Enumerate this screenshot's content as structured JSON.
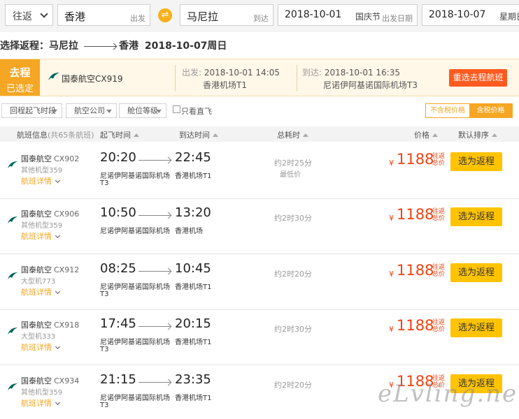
{
  "search": {
    "trip_type": "往返",
    "origin": "香港",
    "origin_hint": "出发",
    "destination": "马尼拉",
    "destination_hint": "到达",
    "depart_date": "2018-10-01",
    "depart_holiday": "国庆节",
    "depart_hint": "出发日期",
    "return_date": "2018-10-07",
    "return_weekday": "星期日"
  },
  "route_title": {
    "prefix": "选择返程：马尼拉",
    "to": "香港",
    "date": "2018-10-07周日"
  },
  "selected": {
    "badge_top": "去程",
    "badge_bottom": "已选定",
    "airline": "国泰航空CX919",
    "dep_label": "出发:",
    "dep_time": "2018-10-01 14:05",
    "dep_airport": "香港机场T1",
    "arr_label": "到达:",
    "arr_time": "2018-10-01 16:35",
    "arr_airport": "尼诺伊阿基诺国际机场T3",
    "reselect_button": "重选去程航班"
  },
  "filters": {
    "time": "回程起飞时段",
    "airline": "航空公司",
    "cabin": "舱位等级",
    "direct_only": "只看直飞",
    "tax_excluded": "不含税价格",
    "tax_included": "含税价格"
  },
  "table_header": {
    "flight_info": "航班信息",
    "flight_count": "(共65条航班)",
    "dep_time": "起飞时间",
    "arr_time": "到达时间",
    "duration": "总耗时",
    "price": "价格",
    "sort": "默认排序"
  },
  "flights": [
    {
      "airline": "国泰航空",
      "no": "CX902",
      "aircraft": "其他机型359",
      "detail": "航班详情",
      "dep": "20:20",
      "arr": "22:45",
      "dep_airport": "尼诺伊阿基诺国际机场",
      "dep_terminal": "T3",
      "arr_airport": "香港机场T1",
      "duration": "约2时25分",
      "lowest": "最低价",
      "currency": "¥",
      "price": "1188",
      "note": "往返总价",
      "button": "选为返程"
    },
    {
      "airline": "国泰航空",
      "no": "CX906",
      "aircraft": "其他机型359",
      "detail": "航班详情",
      "dep": "10:50",
      "arr": "13:20",
      "dep_airport": "尼诺伊阿基诺国际机场",
      "dep_terminal": "",
      "arr_airport": "香港机场",
      "duration": "约2时30分",
      "lowest": "",
      "currency": "¥",
      "price": "1188",
      "note": "往返总价",
      "button": "选为返程"
    },
    {
      "airline": "国泰航空",
      "no": "CX912",
      "aircraft": "大型机773",
      "detail": "航班详情",
      "dep": "08:25",
      "arr": "10:45",
      "dep_airport": "尼诺伊阿基诺国际机场",
      "dep_terminal": "T3",
      "arr_airport": "香港机场T1",
      "duration": "约2时20分",
      "lowest": "",
      "currency": "¥",
      "price": "1188",
      "note": "往返总价",
      "button": "选为返程"
    },
    {
      "airline": "国泰航空",
      "no": "CX918",
      "aircraft": "大型机333",
      "detail": "航班详情",
      "dep": "17:45",
      "arr": "20:15",
      "dep_airport": "尼诺伊阿基诺国际机场",
      "dep_terminal": "T3",
      "arr_airport": "香港机场T1",
      "duration": "约2时30分",
      "lowest": "",
      "currency": "¥",
      "price": "1188",
      "note": "往返总价",
      "button": "选为返程"
    },
    {
      "airline": "国泰航空",
      "no": "CX934",
      "aircraft": "其他机型359",
      "detail": "航班详情",
      "dep": "21:15",
      "arr": "23:35",
      "dep_airport": "尼诺伊阿基诺国际机场",
      "dep_terminal": "T3",
      "arr_airport": "香港机场T1",
      "duration": "约2时20分",
      "lowest": "",
      "currency": "¥",
      "price": "1188",
      "note": "往返总价",
      "button": "选为返程"
    }
  ],
  "watermark": "eLvling.net",
  "colors": {
    "accent": "#f5a623",
    "price": "#f0420f",
    "select_button": "#ffc300",
    "reselect_button": "#ff5a1f",
    "airline_logo": "#00645a"
  }
}
